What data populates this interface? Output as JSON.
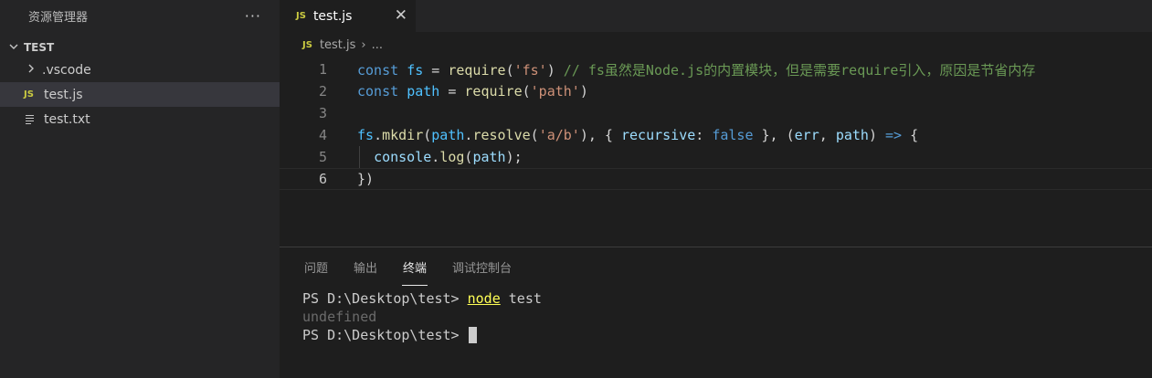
{
  "sidebar": {
    "title": "资源管理器",
    "more": "···",
    "section": "TEST",
    "items": [
      {
        "label": ".vscode"
      },
      {
        "label": "test.js",
        "icon": "JS"
      },
      {
        "label": "test.txt"
      }
    ]
  },
  "editor": {
    "tab": {
      "icon": "JS",
      "label": "test.js",
      "close": "✕"
    },
    "breadcrumb": {
      "icon": "JS",
      "file": "test.js",
      "sep": "›",
      "rest": "..."
    },
    "line_numbers": [
      "1",
      "2",
      "3",
      "4",
      "5",
      "6"
    ],
    "code": {
      "l1": {
        "kw": "const",
        "var": "fs",
        "eq": " = ",
        "fn": "require",
        "p1": "(",
        "str": "'fs'",
        "p2": ") ",
        "comment": "// fs虽然是Node.js的内置模块，但是需要require引入，原因是节省内存"
      },
      "l2": {
        "kw": "const",
        "var": "path",
        "eq": " = ",
        "fn": "require",
        "p1": "(",
        "str": "'path'",
        "p2": ")"
      },
      "l4": {
        "obj": "fs",
        "dot1": ".",
        "fn": "mkdir",
        "p1": "(",
        "obj2": "path",
        "dot2": ".",
        "fn2": "resolve",
        "p2": "(",
        "str": "'a/b'",
        "p3": "), { ",
        "prop": "recursive",
        "colon": ": ",
        "bool": "false",
        "p4": " }, (",
        "arg1": "err",
        "comma": ", ",
        "arg2": "path",
        "p5": ") ",
        "arrow": "=>",
        "p6": " {"
      },
      "l5": {
        "obj": "console",
        "dot": ".",
        "fn": "log",
        "p1": "(",
        "arg": "path",
        "p2": ");"
      },
      "l6": {
        "text": "})"
      }
    }
  },
  "panel": {
    "tabs": [
      "问题",
      "输出",
      "终端",
      "调试控制台"
    ],
    "active_tab": "终端",
    "terminal": {
      "prompt1": "PS D:\\Desktop\\test> ",
      "cmd": "node",
      "arg": " test",
      "output": "undefined",
      "prompt2": "PS D:\\Desktop\\test> "
    }
  },
  "colors": {
    "keyword": "#569cd6",
    "function": "#dcdcaa",
    "string": "#ce9178",
    "comment": "#6a9955",
    "variable": "#4fc1ff",
    "property": "#9cdcfe",
    "js_icon": "#cbcb41"
  }
}
